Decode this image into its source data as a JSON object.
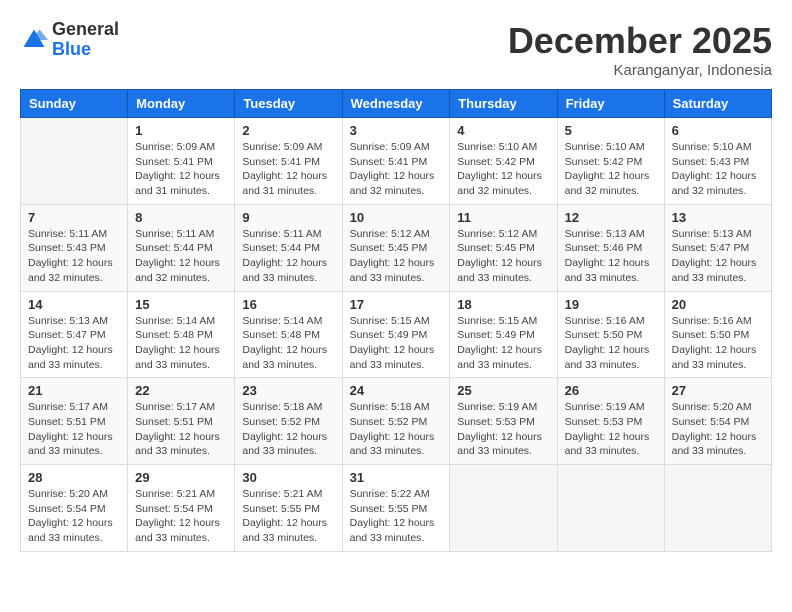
{
  "logo": {
    "general": "General",
    "blue": "Blue"
  },
  "title": "December 2025",
  "subtitle": "Karanganyar, Indonesia",
  "days_of_week": [
    "Sunday",
    "Monday",
    "Tuesday",
    "Wednesday",
    "Thursday",
    "Friday",
    "Saturday"
  ],
  "weeks": [
    [
      {
        "day": "",
        "info": ""
      },
      {
        "day": "1",
        "info": "Sunrise: 5:09 AM\nSunset: 5:41 PM\nDaylight: 12 hours\nand 31 minutes."
      },
      {
        "day": "2",
        "info": "Sunrise: 5:09 AM\nSunset: 5:41 PM\nDaylight: 12 hours\nand 31 minutes."
      },
      {
        "day": "3",
        "info": "Sunrise: 5:09 AM\nSunset: 5:41 PM\nDaylight: 12 hours\nand 32 minutes."
      },
      {
        "day": "4",
        "info": "Sunrise: 5:10 AM\nSunset: 5:42 PM\nDaylight: 12 hours\nand 32 minutes."
      },
      {
        "day": "5",
        "info": "Sunrise: 5:10 AM\nSunset: 5:42 PM\nDaylight: 12 hours\nand 32 minutes."
      },
      {
        "day": "6",
        "info": "Sunrise: 5:10 AM\nSunset: 5:43 PM\nDaylight: 12 hours\nand 32 minutes."
      }
    ],
    [
      {
        "day": "7",
        "info": "Sunrise: 5:11 AM\nSunset: 5:43 PM\nDaylight: 12 hours\nand 32 minutes."
      },
      {
        "day": "8",
        "info": "Sunrise: 5:11 AM\nSunset: 5:44 PM\nDaylight: 12 hours\nand 32 minutes."
      },
      {
        "day": "9",
        "info": "Sunrise: 5:11 AM\nSunset: 5:44 PM\nDaylight: 12 hours\nand 33 minutes."
      },
      {
        "day": "10",
        "info": "Sunrise: 5:12 AM\nSunset: 5:45 PM\nDaylight: 12 hours\nand 33 minutes."
      },
      {
        "day": "11",
        "info": "Sunrise: 5:12 AM\nSunset: 5:45 PM\nDaylight: 12 hours\nand 33 minutes."
      },
      {
        "day": "12",
        "info": "Sunrise: 5:13 AM\nSunset: 5:46 PM\nDaylight: 12 hours\nand 33 minutes."
      },
      {
        "day": "13",
        "info": "Sunrise: 5:13 AM\nSunset: 5:47 PM\nDaylight: 12 hours\nand 33 minutes."
      }
    ],
    [
      {
        "day": "14",
        "info": "Sunrise: 5:13 AM\nSunset: 5:47 PM\nDaylight: 12 hours\nand 33 minutes."
      },
      {
        "day": "15",
        "info": "Sunrise: 5:14 AM\nSunset: 5:48 PM\nDaylight: 12 hours\nand 33 minutes."
      },
      {
        "day": "16",
        "info": "Sunrise: 5:14 AM\nSunset: 5:48 PM\nDaylight: 12 hours\nand 33 minutes."
      },
      {
        "day": "17",
        "info": "Sunrise: 5:15 AM\nSunset: 5:49 PM\nDaylight: 12 hours\nand 33 minutes."
      },
      {
        "day": "18",
        "info": "Sunrise: 5:15 AM\nSunset: 5:49 PM\nDaylight: 12 hours\nand 33 minutes."
      },
      {
        "day": "19",
        "info": "Sunrise: 5:16 AM\nSunset: 5:50 PM\nDaylight: 12 hours\nand 33 minutes."
      },
      {
        "day": "20",
        "info": "Sunrise: 5:16 AM\nSunset: 5:50 PM\nDaylight: 12 hours\nand 33 minutes."
      }
    ],
    [
      {
        "day": "21",
        "info": "Sunrise: 5:17 AM\nSunset: 5:51 PM\nDaylight: 12 hours\nand 33 minutes."
      },
      {
        "day": "22",
        "info": "Sunrise: 5:17 AM\nSunset: 5:51 PM\nDaylight: 12 hours\nand 33 minutes."
      },
      {
        "day": "23",
        "info": "Sunrise: 5:18 AM\nSunset: 5:52 PM\nDaylight: 12 hours\nand 33 minutes."
      },
      {
        "day": "24",
        "info": "Sunrise: 5:18 AM\nSunset: 5:52 PM\nDaylight: 12 hours\nand 33 minutes."
      },
      {
        "day": "25",
        "info": "Sunrise: 5:19 AM\nSunset: 5:53 PM\nDaylight: 12 hours\nand 33 minutes."
      },
      {
        "day": "26",
        "info": "Sunrise: 5:19 AM\nSunset: 5:53 PM\nDaylight: 12 hours\nand 33 minutes."
      },
      {
        "day": "27",
        "info": "Sunrise: 5:20 AM\nSunset: 5:54 PM\nDaylight: 12 hours\nand 33 minutes."
      }
    ],
    [
      {
        "day": "28",
        "info": "Sunrise: 5:20 AM\nSunset: 5:54 PM\nDaylight: 12 hours\nand 33 minutes."
      },
      {
        "day": "29",
        "info": "Sunrise: 5:21 AM\nSunset: 5:54 PM\nDaylight: 12 hours\nand 33 minutes."
      },
      {
        "day": "30",
        "info": "Sunrise: 5:21 AM\nSunset: 5:55 PM\nDaylight: 12 hours\nand 33 minutes."
      },
      {
        "day": "31",
        "info": "Sunrise: 5:22 AM\nSunset: 5:55 PM\nDaylight: 12 hours\nand 33 minutes."
      },
      {
        "day": "",
        "info": ""
      },
      {
        "day": "",
        "info": ""
      },
      {
        "day": "",
        "info": ""
      }
    ]
  ]
}
